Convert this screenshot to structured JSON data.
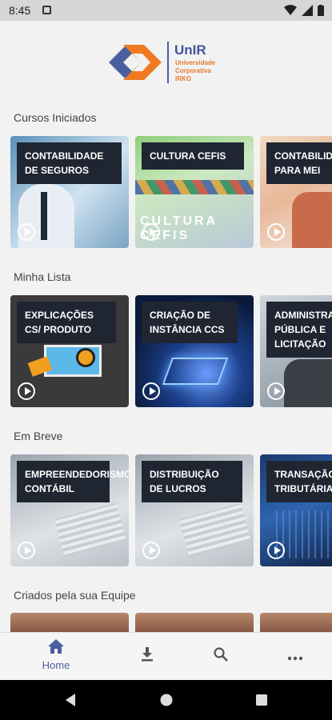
{
  "status_bar": {
    "time": "8:45"
  },
  "logo": {
    "title": "UnIR",
    "line1": "Universidade",
    "line2": "Corporativa",
    "line3": "IRKO"
  },
  "sections": [
    {
      "title": "Cursos Iniciados",
      "cards": [
        {
          "label": "CONTABILIDADE DE SEGUROS"
        },
        {
          "label": "CULTURA CEFIS",
          "overlay": "CULTURA CEFIS"
        },
        {
          "label": "CONTABILIDADE PARA MEI"
        }
      ]
    },
    {
      "title": "Minha Lista",
      "cards": [
        {
          "label": "EXPLICAÇÕES CS/ PRODUTO"
        },
        {
          "label": "CRIAÇÃO DE INSTÂNCIA CCS"
        },
        {
          "label": "ADMINISTRAÇÃO PÚBLICA E LICITAÇÃO"
        }
      ]
    },
    {
      "title": "Em Breve",
      "cards": [
        {
          "label": "EMPREENDEDORISMO CONTÁBIL"
        },
        {
          "label": "DISTRIBUIÇÃO DE LUCROS"
        },
        {
          "label": "TRANSAÇÃO TRIBUTÁRIA"
        }
      ]
    },
    {
      "title": "Criados pela sua Equipe",
      "cards": []
    }
  ],
  "bottom_nav": {
    "home_label": "Home"
  },
  "colors": {
    "accent": "#4a5fa0",
    "card_label_bg": "#1f2632"
  }
}
